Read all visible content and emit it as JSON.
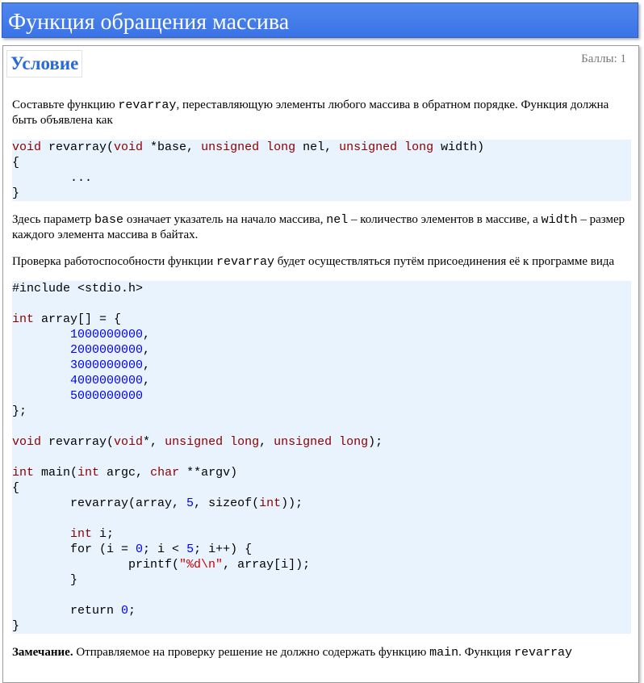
{
  "page": {
    "title": "Функция обращения массива"
  },
  "condition": {
    "label": "Условие",
    "score": "Баллы: 1"
  },
  "text": {
    "p1_a": "Составьте функцию ",
    "p1_code": "revarray",
    "p1_b": ", переставляющую элементы любого массива в обратном порядке. Функция должна быть объявлена как",
    "p2_a": "Здесь параметр ",
    "p2_code1": "base",
    "p2_b": " означает указатель на начало массива, ",
    "p2_code2": "nel",
    "p2_c": " – количество элементов в массиве, а ",
    "p2_code3": "width",
    "p2_d": " – размер каждого элемента массива в байтах.",
    "p3_a": "Проверка работоспособности функции ",
    "p3_code": "revarray",
    "p3_b": " будет осуществляться путём присоединения её к программе вида",
    "p4_bold": "Замечание.",
    "p4_a": " Отправляемое на проверку решение не должно содержать функцию ",
    "p4_code1": "main",
    "p4_b": ". Функция ",
    "p4_code2": "revarray"
  },
  "code1": {
    "l1": [
      "void",
      " revarray(",
      "void",
      " *base, ",
      "unsigned long",
      " nel, ",
      "unsigned long",
      " width)"
    ],
    "l2": "{",
    "l3": "        ...",
    "l4": "}"
  },
  "code2": {
    "include": "#include <stdio.h>",
    "arr_kw": "int",
    "arr_rest": " array[] = {",
    "values": [
      "1000000000",
      "2000000000",
      "3000000000",
      "4000000000",
      "5000000000"
    ],
    "arr_close": "};",
    "proto": [
      "void",
      " revarray(",
      "void",
      "*, ",
      "unsigned long",
      ", ",
      "unsigned long",
      ");"
    ],
    "main": [
      "int",
      " main(",
      "int",
      " argc, ",
      "char",
      " **argv)"
    ],
    "open": "{",
    "call_a": "        revarray(array, ",
    "call_num": "5",
    "call_b": ", sizeof(",
    "call_kw": "int",
    "call_c": "));",
    "decl_kw": "int",
    "decl_rest": " i;",
    "for_a": "        for (i = ",
    "for_n1": "0",
    "for_b": "; i < ",
    "for_n2": "5",
    "for_c": "; i++) {",
    "printf_a": "                printf(",
    "printf_str": "\"%d\\n\"",
    "printf_b": ", array[i]);",
    "close_inner": "        }",
    "ret_a": "        return ",
    "ret_num": "0",
    "ret_b": ";",
    "close": "}"
  }
}
